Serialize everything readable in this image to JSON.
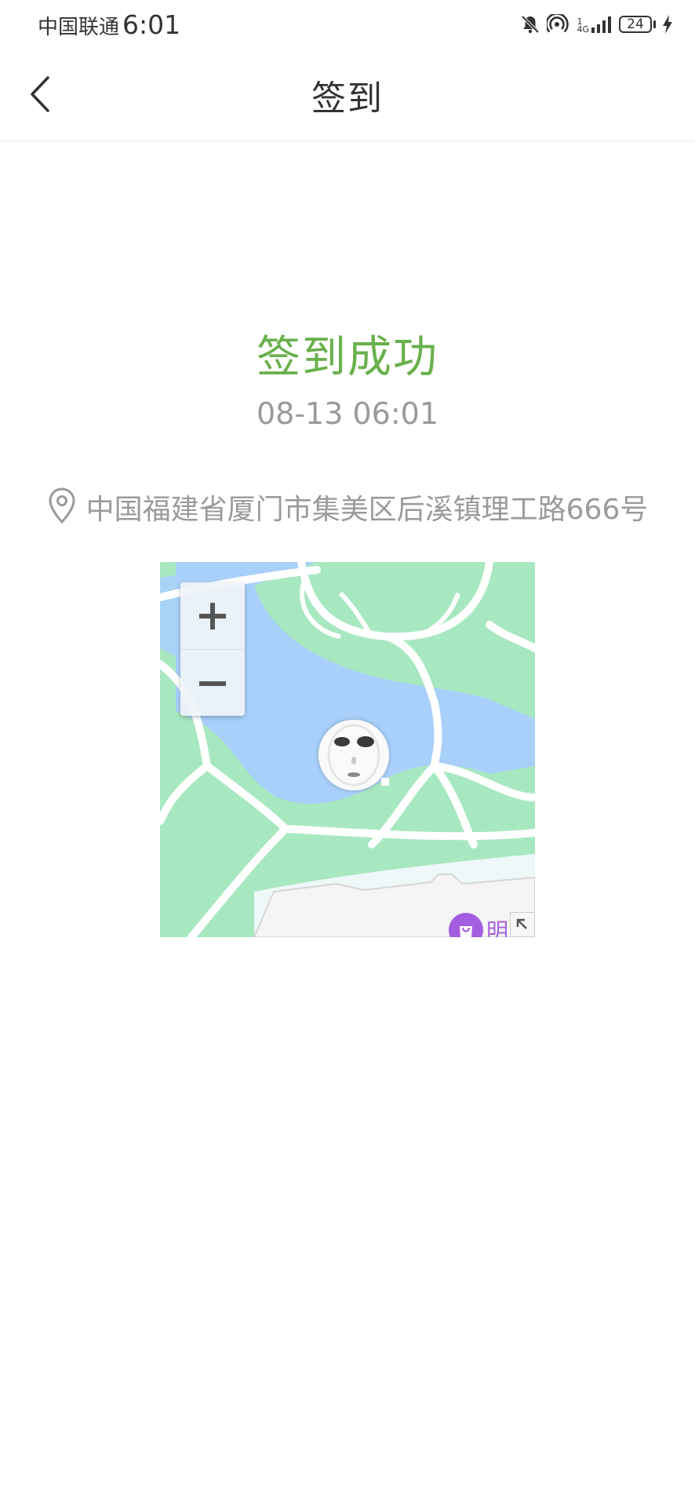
{
  "status_bar": {
    "carrier": "中国联通",
    "time": "6:01",
    "network_sup": "1",
    "network_type": "4G",
    "battery": "24",
    "icons": [
      "mute-bell-icon",
      "hotspot-icon",
      "signal-icon",
      "battery-icon",
      "charging-icon"
    ]
  },
  "nav": {
    "title": "签到",
    "back_icon": "chevron-left-icon"
  },
  "result": {
    "title": "签到成功",
    "time": "08-13 06:01",
    "title_color": "#6ab04c"
  },
  "location": {
    "icon": "location-pin-icon",
    "address": "中国福建省厦门市集美区后溪镇理工路666号"
  },
  "map": {
    "zoom_in_label": "+",
    "zoom_out_label": "−",
    "poi_label": "明",
    "colors": {
      "water": "#a9d0fb",
      "green": "#a8e8c0",
      "road": "#ffffff",
      "building": "#f5f5f3",
      "poi": "#a45de0"
    }
  }
}
